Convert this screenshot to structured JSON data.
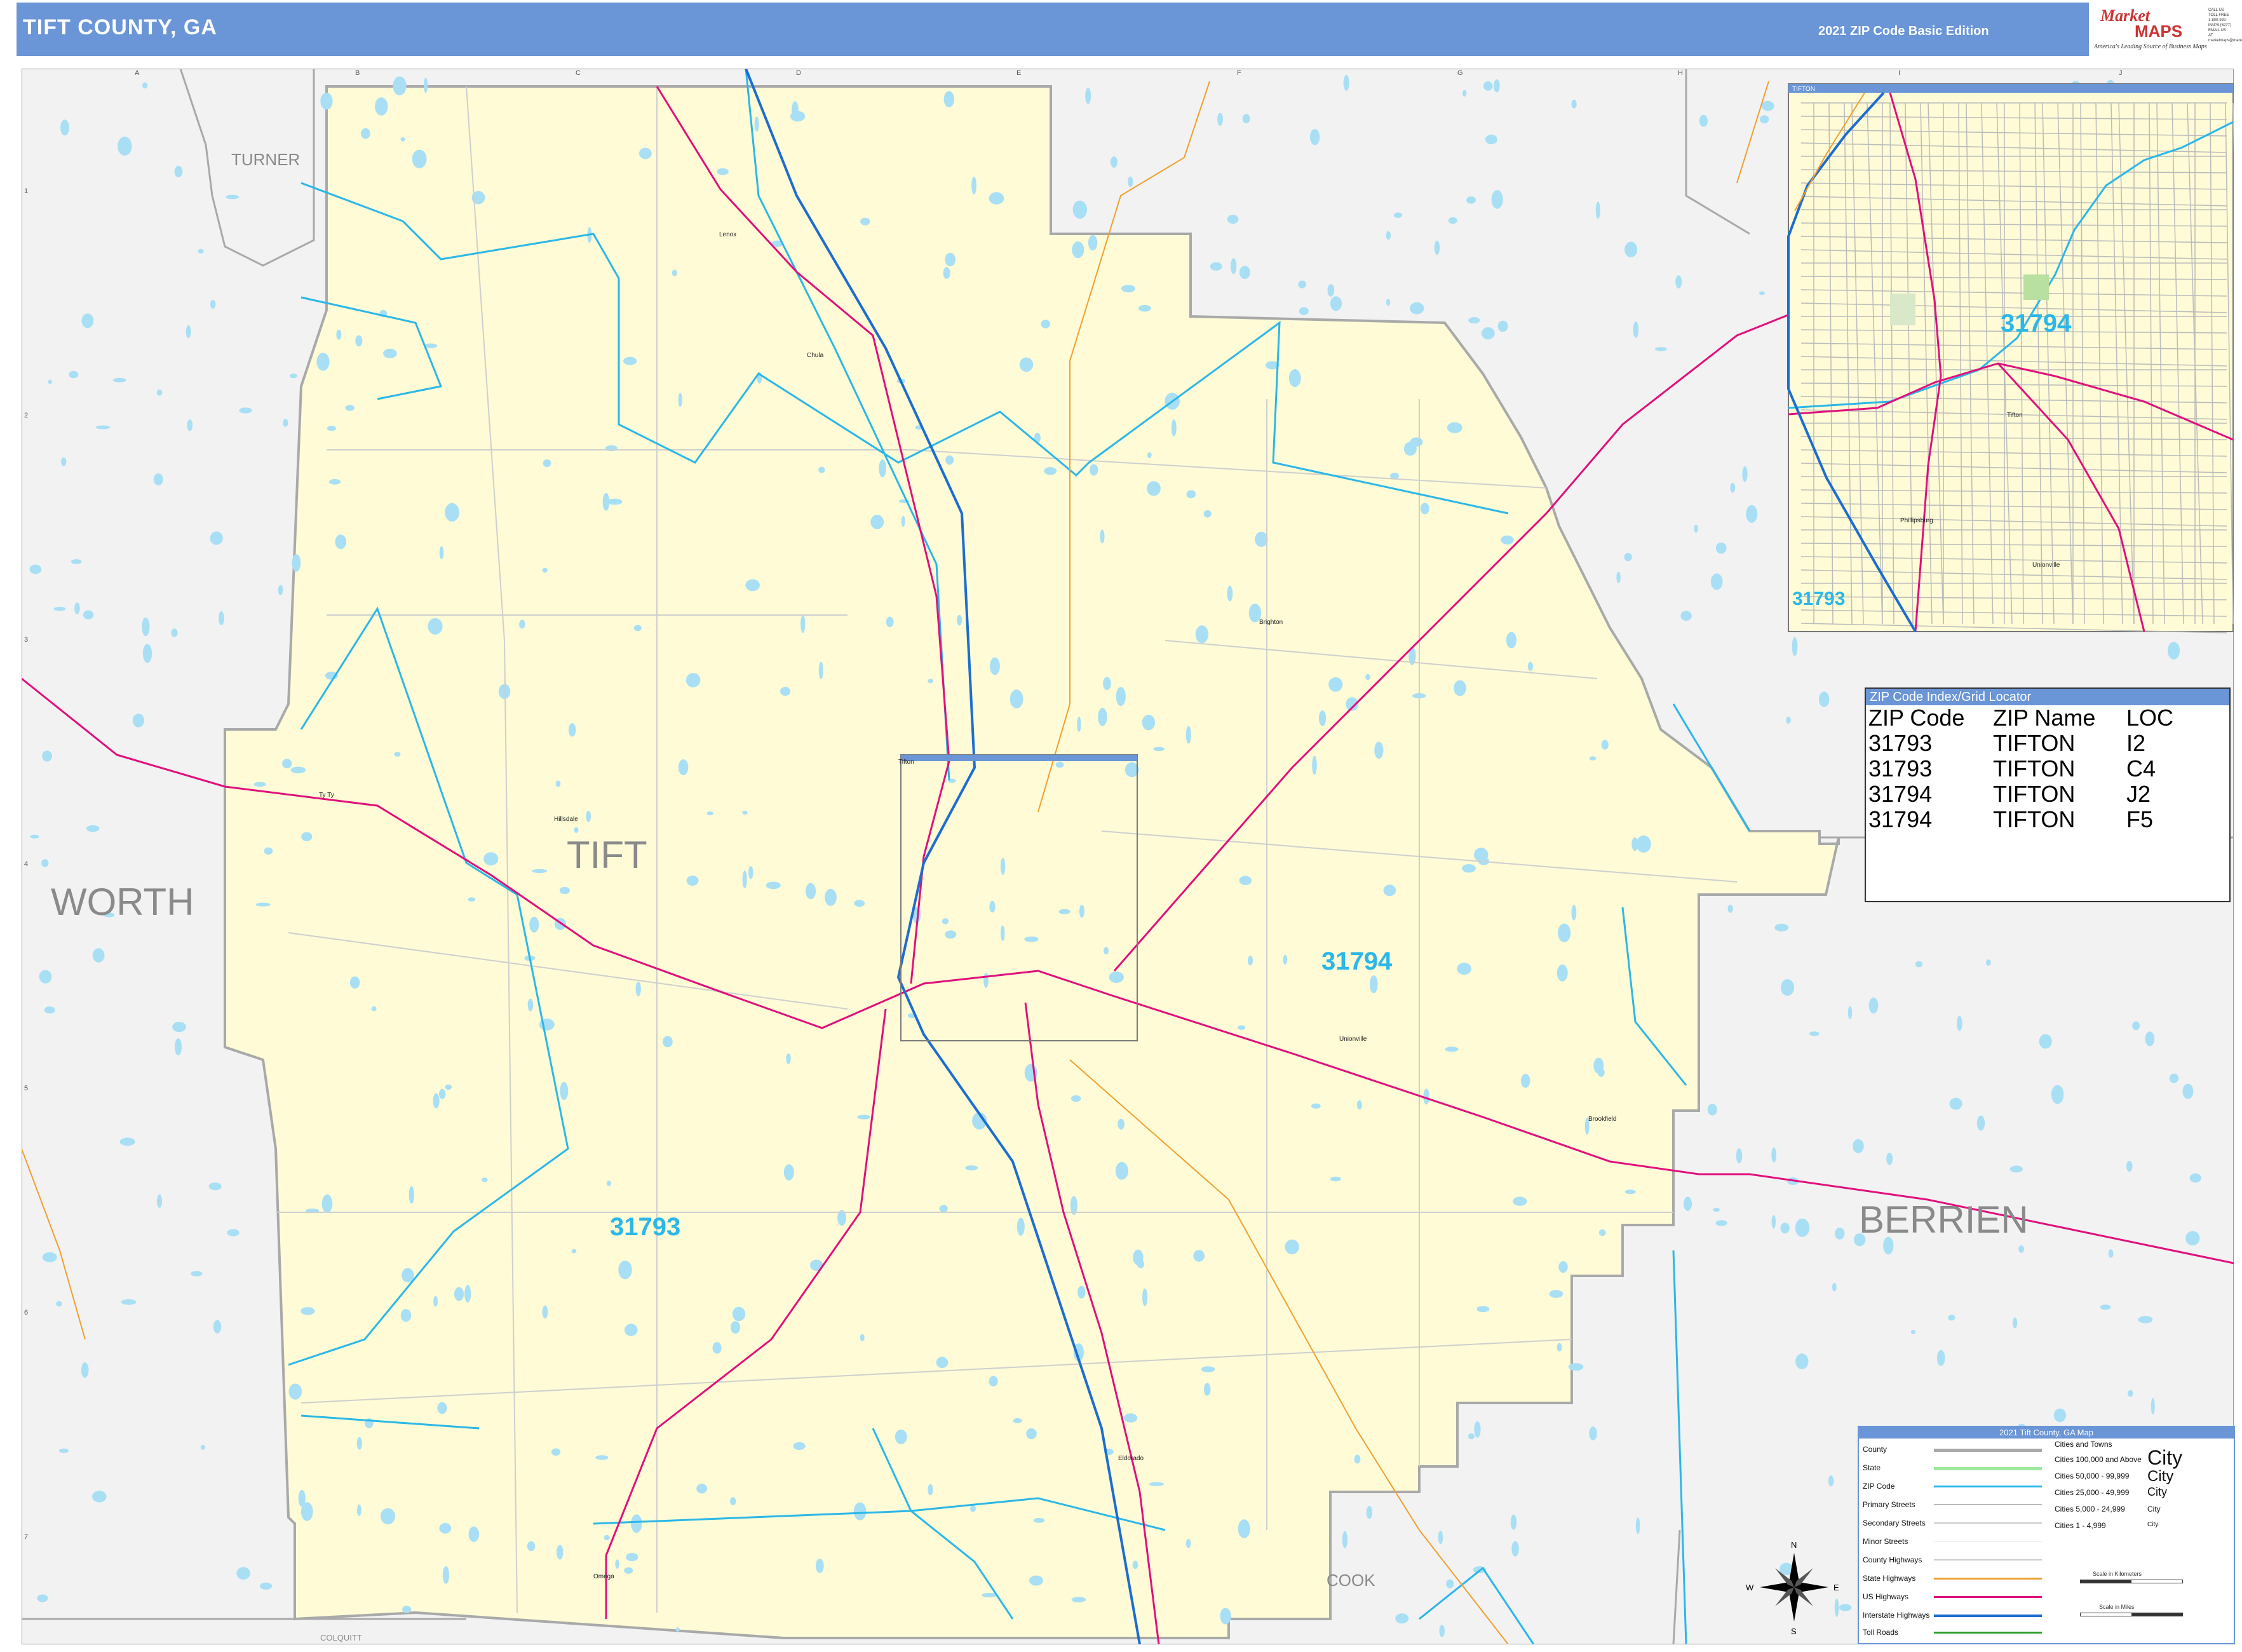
{
  "header": {
    "title": "TIFT COUNTY, GA",
    "edition": "2021 ZIP Code Basic Edition",
    "logo": {
      "brand_top": "Market",
      "brand_bottom": "MAPS",
      "tagline": "America's Leading Source of Business Maps",
      "contact": "CALL US TOLL FREE 1-800-929-MAPS (6277) EMAIL US AT marketmaps@marketmaps.com"
    }
  },
  "map": {
    "county_labels": [
      "TURNER",
      "WORTH",
      "TIFT",
      "BERRIEN",
      "COOK",
      "COLQUITT"
    ],
    "zip_labels": [
      "31794",
      "31793"
    ],
    "city_labels": [
      "Brookfield",
      "Chula",
      "Brighton",
      "Ty Ty",
      "Hillsdale",
      "Lenox",
      "Eldorado",
      "Omega",
      "Unionville",
      "Tifton"
    ],
    "grid_columns": [
      "A",
      "B",
      "C",
      "D",
      "E",
      "F",
      "G",
      "H",
      "I",
      "J"
    ],
    "grid_rows": [
      "1",
      "2",
      "3",
      "4",
      "5",
      "6",
      "7"
    ],
    "colors": {
      "county_fill": "#fefbd6",
      "outside_fill": "#f2f2f2",
      "zip_boundary": "#2bb7e8",
      "county_boundary": "#a9a9a9",
      "us_highway": "#e0107c",
      "interstate": "#1c6dd0",
      "state_highway": "#f0a030",
      "water": "#a8dff5"
    }
  },
  "inset": {
    "title": "TIFTON",
    "zip_labels": [
      "31794",
      "31793"
    ],
    "city_labels": [
      "Tifton",
      "Phillipsburg",
      "Unionville"
    ]
  },
  "zip_index": {
    "title": "ZIP Code Index/Grid Locator",
    "headers": [
      "ZIP Code",
      "ZIP Name",
      "LOC"
    ],
    "rows": [
      [
        "31793",
        "TIFTON",
        "I2"
      ],
      [
        "31793",
        "TIFTON",
        "C4"
      ],
      [
        "31794",
        "TIFTON",
        "J2"
      ],
      [
        "31794",
        "TIFTON",
        "F5"
      ]
    ]
  },
  "legend": {
    "title": "2021 Tift County, GA Map",
    "rows": [
      "County",
      "State",
      "ZIP Code",
      "Primary Streets",
      "Secondary Streets",
      "Minor Streets",
      "County Highways",
      "State Highways",
      "US Highways",
      "Interstate Highways",
      "Toll Roads"
    ],
    "cities_title": "Cities and Towns",
    "cities": [
      "Cities 100,000 and Above",
      "Cities 50,000 - 99,999",
      "Cities 25,000 - 49,999",
      "Cities 5,000 - 24,999",
      "Cities 1 - 4,999"
    ],
    "city_sample": "City",
    "scale_km": "Scale in Kilometers",
    "scale_mi": "Scale in Miles",
    "compass": [
      "N",
      "E",
      "S",
      "W"
    ]
  }
}
